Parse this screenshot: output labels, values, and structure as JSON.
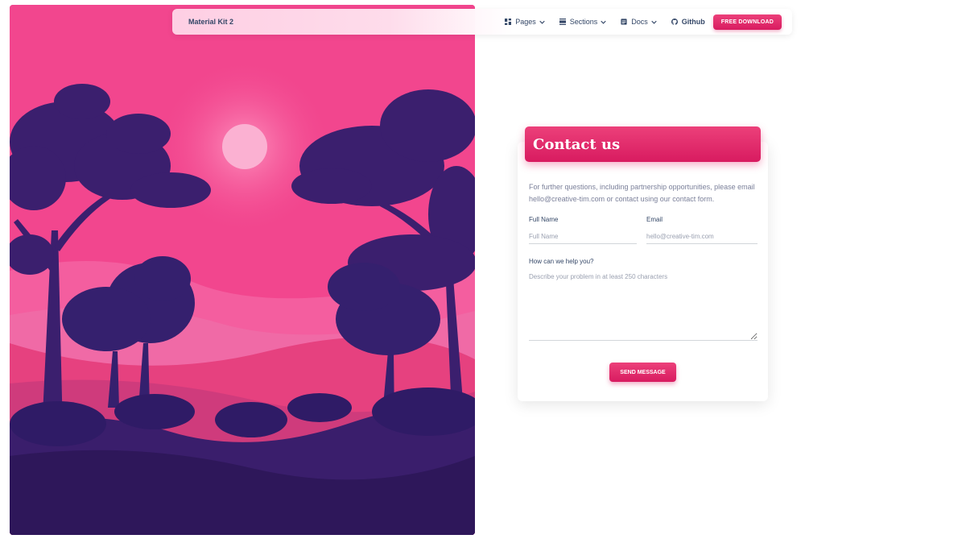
{
  "navbar": {
    "brand": "Material Kit 2",
    "items": [
      {
        "label": "Pages",
        "icon": "dashboard-icon"
      },
      {
        "label": "Sections",
        "icon": "view-day-icon"
      },
      {
        "label": "Docs",
        "icon": "article-icon"
      }
    ],
    "github_label": "Github",
    "download_label": "FREE DOWNLOAD"
  },
  "contact": {
    "title": "Contact us",
    "intro": "For further questions, including partnership opportunities, please email hello@creative-tim.com or contact using our contact form.",
    "full_name": {
      "label": "Full Name",
      "placeholder": "Full Name"
    },
    "email": {
      "label": "Email",
      "placeholder": "hello@creative-tim.com"
    },
    "message": {
      "label": "How can we help you?",
      "placeholder": "Describe your problem in at least 250 characters"
    },
    "send_label": "SEND MESSAGE"
  },
  "colors": {
    "accent": "#e91e63",
    "hero_pink": "#f2468e",
    "tree_purple": "#3b1f6e"
  }
}
